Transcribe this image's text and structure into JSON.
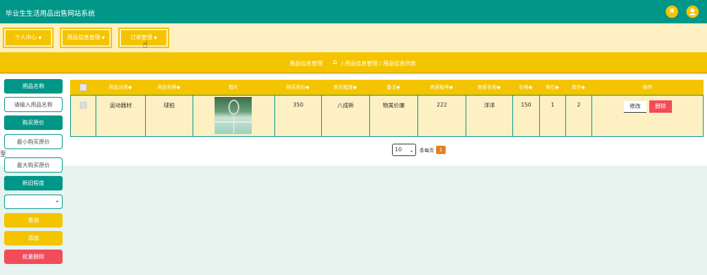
{
  "header": {
    "title": "毕业生生活用品出售网站系统",
    "icon1": "close-x-icon",
    "icon2": "user-icon"
  },
  "nav": {
    "items": [
      {
        "label": "个人中心"
      },
      {
        "label": "用品信息管理"
      },
      {
        "label": "订单管理"
      }
    ]
  },
  "breadcrumb": {
    "section": "用品信息管理",
    "path": "/ 用品信息管理 / 用品信息列表"
  },
  "sidebar": {
    "name_label": "用品名称",
    "name_placeholder": "请输入用品名称",
    "price_label": "购买原价",
    "min_price_placeholder": "最小购买原价",
    "to_label": "至",
    "max_price_placeholder": "最大购买原价",
    "condition_label": "新旧程度",
    "condition_value": "",
    "query_button": "查询",
    "add_button": "添加",
    "batch_delete_button": "批量删除"
  },
  "table": {
    "headers": [
      "",
      "用品分类◆",
      "用品名称◆",
      "图片",
      "购买原价◆",
      "新旧程度◆",
      "备注◆",
      "商家账号◆",
      "商家名称◆",
      "价格◆",
      "单位◆",
      "库存◆",
      "操作"
    ],
    "rows": [
      {
        "category": "运动器材",
        "name": "球拍",
        "image": "badminton-racket-photo",
        "original_price": "350",
        "condition": "八成新",
        "note": "物美价廉",
        "seller_account": "222",
        "seller_name": "洋洋",
        "price": "150",
        "unit": "1",
        "stock": "2",
        "edit": "修改",
        "delete": "删除"
      }
    ]
  },
  "pagination": {
    "page_size": "10",
    "per_page_text": "条每页",
    "current_page": "1"
  },
  "colors": {
    "teal": "#009688",
    "yellow": "#f5c400",
    "cream": "#fdf0c2",
    "red": "#f24c5a",
    "orange": "#e67e22"
  }
}
